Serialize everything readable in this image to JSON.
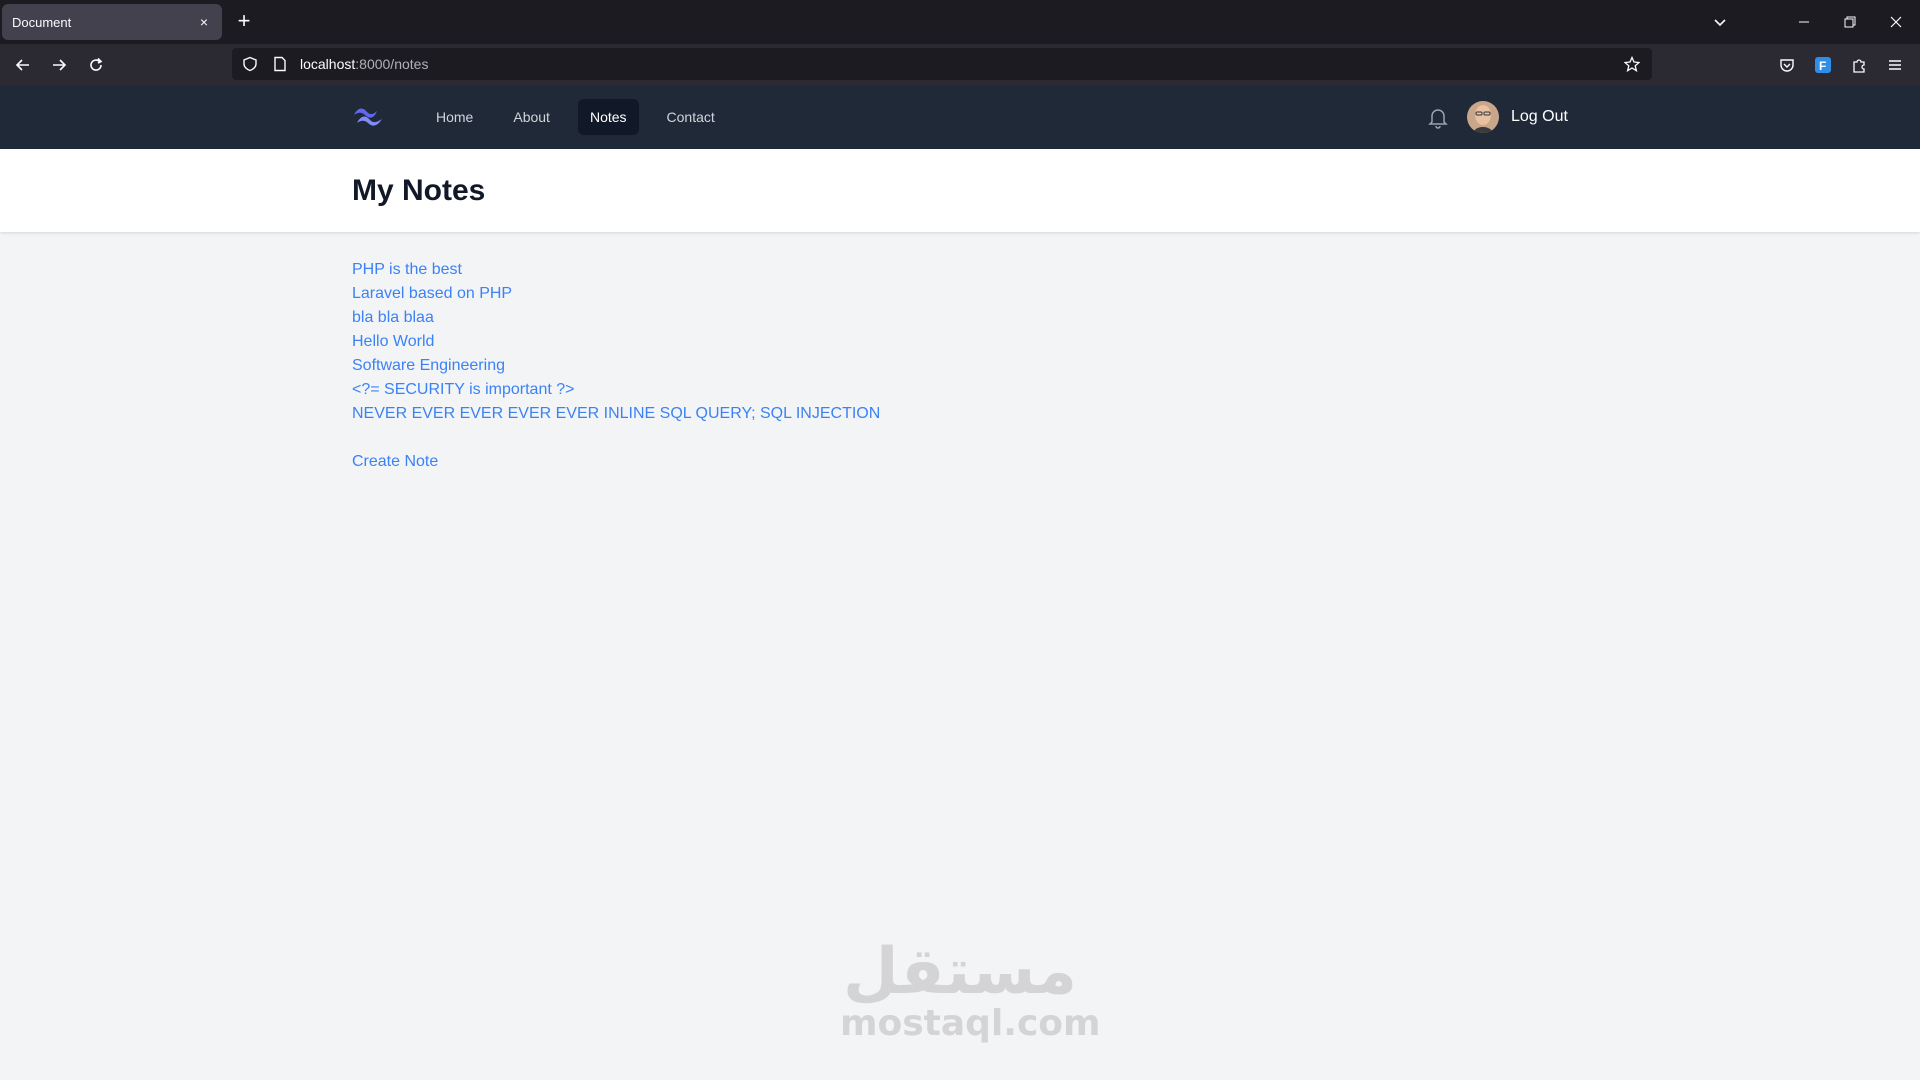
{
  "browser": {
    "tab_title": "Document",
    "tab_close": "×",
    "new_tab": "+",
    "url_host": "localhost",
    "url_path": ":8000/notes"
  },
  "site": {
    "nav": {
      "links": [
        {
          "label": "Home",
          "active": false
        },
        {
          "label": "About",
          "active": false
        },
        {
          "label": "Notes",
          "active": true
        },
        {
          "label": "Contact",
          "active": false
        }
      ],
      "logout_label": "Log Out"
    },
    "header": {
      "title": "My Notes"
    },
    "notes": [
      "PHP is the best",
      "Laravel based on PHP",
      "bla bla blaa",
      "Hello World",
      "Software Engineering",
      "<?= SECURITY is important ?>",
      "NEVER EVER EVER EVER EVER INLINE SQL QUERY; SQL INJECTION"
    ],
    "create_note_label": "Create Note"
  },
  "watermark": {
    "arabic": "مستقل",
    "latin": "mostaql.com"
  },
  "colors": {
    "nav_bg": "#1f2937",
    "link": "#3b82f6",
    "page_bg": "#f3f4f6"
  }
}
